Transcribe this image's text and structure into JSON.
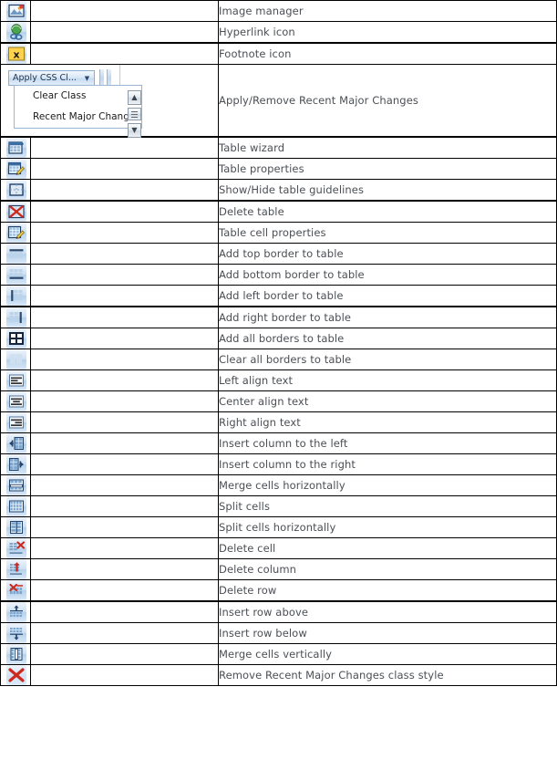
{
  "document": {
    "type": "icon-reference-table",
    "columns": [
      "icon",
      "spacer",
      "description"
    ]
  },
  "css_widget": {
    "button_label": "Apply CSS Cl...",
    "button_icon": "chevron-down-icon",
    "dropdown_items": [
      {
        "label": "Clear Class"
      },
      {
        "label": "Recent Major Chang"
      }
    ],
    "scrollbar": {
      "up_glyph": "˄",
      "down_glyph": "˅",
      "thumb": "scroll-thumb"
    }
  },
  "rows": [
    {
      "icon": "image-manager-icon",
      "label": "Image manager",
      "thick_bottom": false
    },
    {
      "icon": "hyperlink-icon",
      "label": "Hyperlink icon",
      "thick_bottom": true
    },
    {
      "icon": "footnote-icon",
      "label": "Footnote icon",
      "thick_bottom": false
    },
    {
      "icon": "apply-css-class-widget",
      "label": "Apply/Remove Recent Major Changes",
      "thick_bottom": true,
      "widget": true
    },
    {
      "icon": "table-wizard-icon",
      "label": "Table wizard",
      "thick_bottom": false
    },
    {
      "icon": "table-properties-icon",
      "label": "Table properties",
      "thick_bottom": false
    },
    {
      "icon": "show-hide-guidelines-icon",
      "label": "Show/Hide table guidelines",
      "thick_bottom": true
    },
    {
      "icon": "delete-table-icon",
      "label": "Delete table",
      "thick_bottom": false
    },
    {
      "icon": "table-cell-properties-icon",
      "label": "Table cell properties",
      "thick_bottom": false
    },
    {
      "icon": "add-top-border-icon",
      "label": "Add top border to table",
      "thick_bottom": false
    },
    {
      "icon": "add-bottom-border-icon",
      "label": "Add bottom border to table",
      "thick_bottom": false
    },
    {
      "icon": "add-left-border-icon",
      "label": "Add left border to table",
      "thick_bottom": true
    },
    {
      "icon": "add-right-border-icon",
      "label": "Add right border to table",
      "thick_bottom": false
    },
    {
      "icon": "add-all-borders-icon",
      "label": "Add all borders to table",
      "thick_bottom": false
    },
    {
      "icon": "clear-all-borders-icon",
      "label": "Clear all borders to table",
      "thick_bottom": false
    },
    {
      "icon": "align-left-icon",
      "label": "Left align text",
      "thick_bottom": false
    },
    {
      "icon": "align-center-icon",
      "label": "Center align text",
      "thick_bottom": false
    },
    {
      "icon": "align-right-icon",
      "label": "Right align text",
      "thick_bottom": false
    },
    {
      "icon": "insert-column-left-icon",
      "label": "Insert column to the left",
      "thick_bottom": false
    },
    {
      "icon": "insert-column-right-icon",
      "label": "Insert column to the right",
      "thick_bottom": false
    },
    {
      "icon": "merge-cells-horizontally-icon",
      "label": "Merge cells horizontally",
      "thick_bottom": false
    },
    {
      "icon": "split-cells-icon",
      "label": "Split cells",
      "thick_bottom": false
    },
    {
      "icon": "split-cells-horizontally-icon",
      "label": "Split cells horizontally",
      "thick_bottom": false
    },
    {
      "icon": "delete-cell-icon",
      "label": "Delete cell",
      "thick_bottom": false
    },
    {
      "icon": "delete-column-icon",
      "label": "Delete column",
      "thick_bottom": false
    },
    {
      "icon": "delete-row-icon",
      "label": "Delete row",
      "thick_bottom": true
    },
    {
      "icon": "insert-row-above-icon",
      "label": "Insert row above",
      "thick_bottom": false
    },
    {
      "icon": "insert-row-below-icon",
      "label": "Insert row below",
      "thick_bottom": false
    },
    {
      "icon": "merge-cells-vertically-icon",
      "label": "Merge cells vertically",
      "thick_bottom": false
    },
    {
      "icon": "remove-class-style-icon",
      "label": "Remove Recent Major Changes class style",
      "thick_bottom": false
    }
  ],
  "colors": {
    "icon_blue": "#3b6ea5",
    "icon_dark": "#1f3f6b",
    "accent_red": "#cc2a20",
    "accent_yellow": "#ffd24d",
    "text": "#4b4f54",
    "border": "#000000"
  }
}
